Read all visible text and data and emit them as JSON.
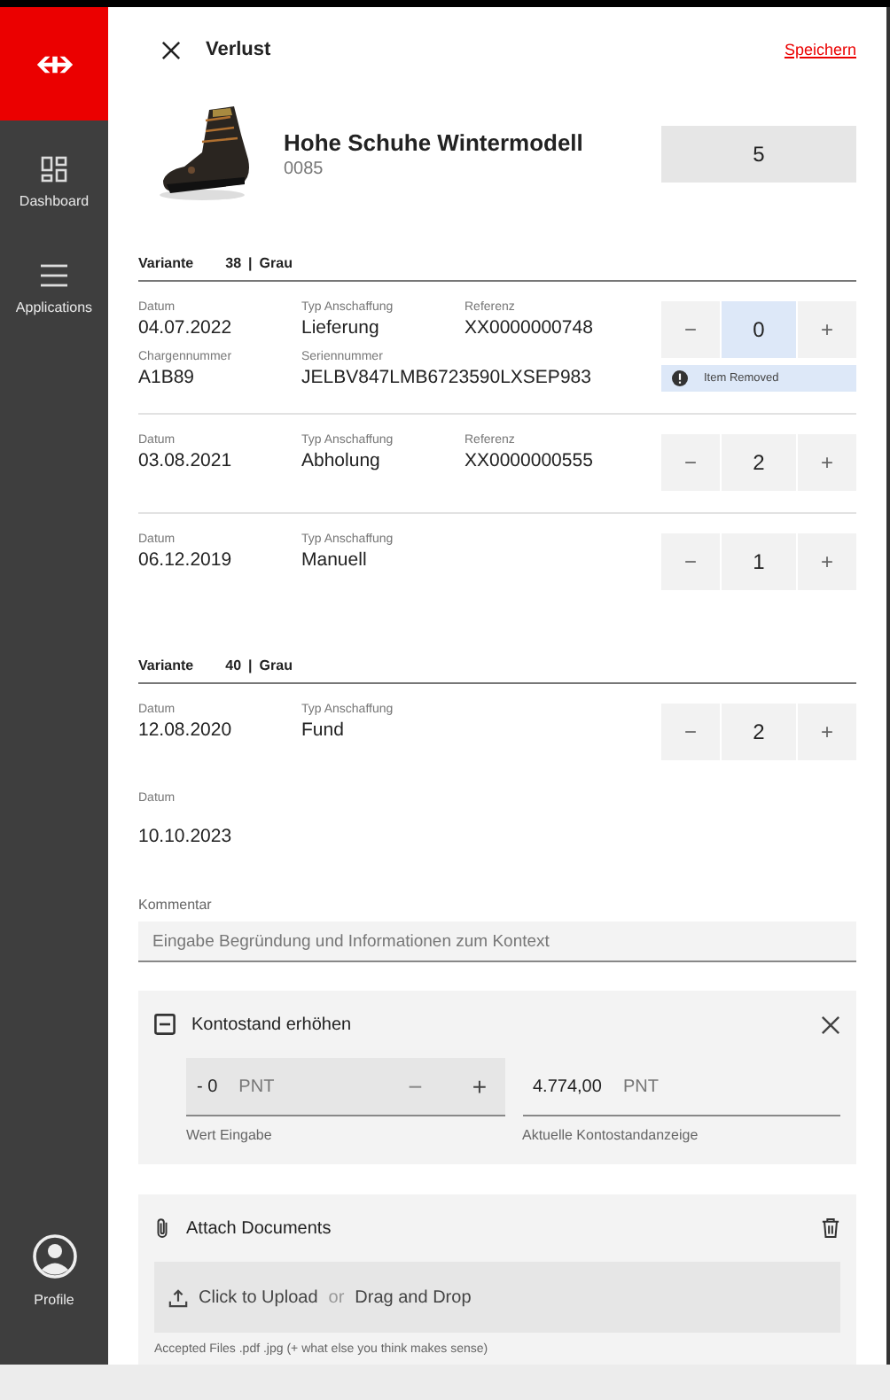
{
  "sidebar": {
    "items": [
      {
        "label": "Dashboard",
        "kind": "grid"
      },
      {
        "label": "Applications",
        "kind": "menu"
      }
    ],
    "profile": {
      "label": "Profile"
    }
  },
  "header": {
    "title": "Verlust",
    "save": "Speichern"
  },
  "product": {
    "name": "Hohe Schuhe Wintermodell",
    "code": "0085",
    "quantity": "5"
  },
  "variants": [
    {
      "label": "Variante",
      "size": "38",
      "separator": "|",
      "color_name": "Grau",
      "entries": [
        {
          "fields": [
            [
              {
                "label": "Datum",
                "value": "04.07.2022"
              },
              {
                "label": "Typ Anschaffung",
                "value": "Lieferung"
              },
              {
                "label": "Referenz",
                "value": "XX0000000748"
              }
            ],
            [
              {
                "label": "Chargennummer",
                "value": "A1B89"
              },
              {
                "label": "Seriennummer",
                "value": "JELBV847LMB6723590LXSEP983"
              }
            ]
          ],
          "quantity": {
            "value": "0",
            "highlighted": true,
            "minus": "−",
            "plus": "+"
          },
          "notice": "Item Removed"
        },
        {
          "fields": [
            [
              {
                "label": "Datum",
                "value": "03.08.2021"
              },
              {
                "label": "Typ Anschaffung",
                "value": "Abholung"
              },
              {
                "label": "Referenz",
                "value": "XX0000000555"
              }
            ]
          ],
          "quantity": {
            "value": "2",
            "highlighted": false,
            "minus": "−",
            "plus": "+"
          }
        },
        {
          "fields": [
            [
              {
                "label": "Datum",
                "value": "06.12.2019"
              },
              {
                "label": "Typ Anschaffung",
                "value": "Manuell"
              }
            ]
          ],
          "quantity": {
            "value": "1",
            "highlighted": false,
            "minus": "−",
            "plus": "+"
          }
        }
      ]
    },
    {
      "label": "Variante",
      "size": "40",
      "separator": "|",
      "color_name": "Grau",
      "entries": [
        {
          "fields": [
            [
              {
                "label": "Datum",
                "value": "12.08.2020"
              },
              {
                "label": "Typ Anschaffung",
                "value": "Fund"
              }
            ]
          ],
          "quantity": {
            "value": "2",
            "highlighted": false,
            "minus": "−",
            "plus": "+"
          }
        },
        {
          "fields": [
            [
              {
                "label": "Datum",
                "value": "10.10.2023"
              }
            ]
          ]
        }
      ]
    }
  ],
  "comment": {
    "label": "Kommentar",
    "placeholder": "Eingabe Begründung und Informationen zum Kontext"
  },
  "balance": {
    "title": "Kontostand erhöhen",
    "input": {
      "value": "- 0",
      "unit": "PNT",
      "minus": "−",
      "minus_disabled": true,
      "plus": "+",
      "label": "Wert Eingabe"
    },
    "current": {
      "value": "4.774,00",
      "unit": "PNT",
      "label": "Aktuelle Kontostandanzeige"
    }
  },
  "attach": {
    "title": "Attach Documents",
    "upload": {
      "action": "Click to Upload",
      "separator": "or",
      "alternative": "Drag and Drop"
    },
    "hint": "Accepted Files .pdf .jpg (+ what else you think makes sense)"
  }
}
